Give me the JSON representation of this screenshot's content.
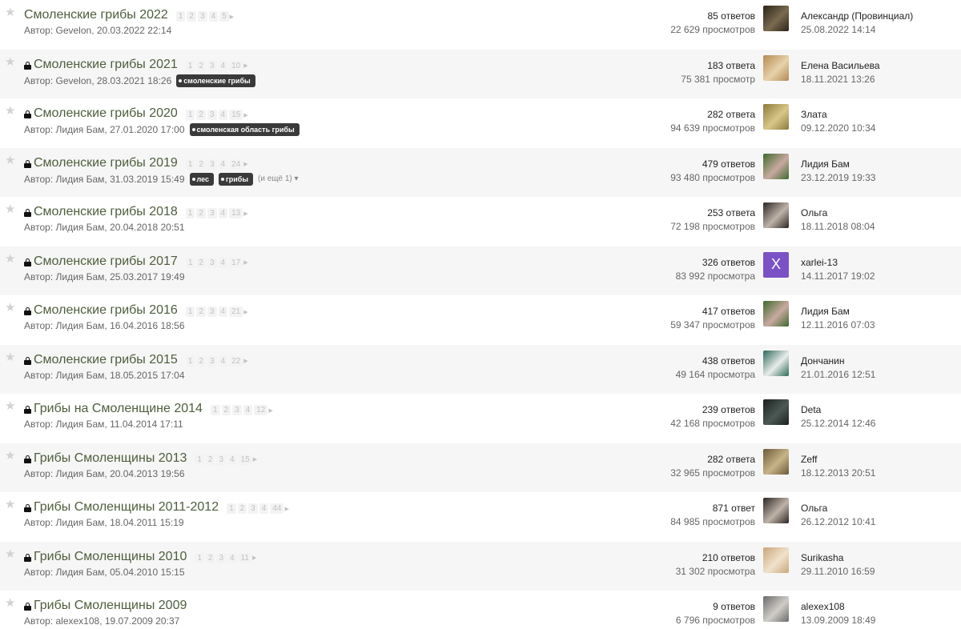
{
  "colors": {
    "accent": "#4e5e3c",
    "tag_bg": "#3a3a3a",
    "row_alt": "#f6f6f6"
  },
  "icons": {
    "star": "star-icon",
    "lock": "lock-icon",
    "page_next": "caret-right-icon",
    "more": "caret-down-icon"
  },
  "topics": [
    {
      "title": "Смоленские грибы 2022",
      "locked": false,
      "pages": [
        "1",
        "2",
        "3",
        "4",
        "5"
      ],
      "author": "Автор: Gevelon, 20.03.2022 22:14",
      "tags": [],
      "more": "",
      "replies": "85 ответов",
      "views": "22 629 просмотров",
      "avatar": {
        "type": "photo",
        "colors": [
          "#2a2418",
          "#7a6a50"
        ]
      },
      "last_user": "Александр (Провинциал)",
      "last_date": "25.08.2022 14:14"
    },
    {
      "title": "Смоленские грибы 2021",
      "locked": true,
      "pages": [
        "1",
        "2",
        "3",
        "4",
        "10"
      ],
      "author": "Автор: Gevelon, 28.03.2021 18:26",
      "tags": [
        "смоленские грибы"
      ],
      "more": "",
      "replies": "183 ответа",
      "views": "75 381 просмотр",
      "avatar": {
        "type": "photo",
        "colors": [
          "#b58a52",
          "#e7d2aa"
        ]
      },
      "last_user": "Елена Васильева",
      "last_date": "18.11.2021 13:26"
    },
    {
      "title": "Смоленские грибы 2020",
      "locked": true,
      "pages": [
        "1",
        "2",
        "3",
        "4",
        "15"
      ],
      "author": "Автор: Лидия Бам, 27.01.2020 17:00",
      "tags": [
        "смоленская область грибы"
      ],
      "more": "",
      "replies": "282 ответа",
      "views": "94 639 просмотров",
      "avatar": {
        "type": "photo",
        "colors": [
          "#8a7a3a",
          "#d9c78a"
        ]
      },
      "last_user": "Злата",
      "last_date": "09.12.2020 10:34"
    },
    {
      "title": "Смоленские грибы 2019",
      "locked": true,
      "pages": [
        "1",
        "2",
        "3",
        "4",
        "24"
      ],
      "author": "Автор: Лидия Бам, 31.03.2019 15:49",
      "tags": [
        "лес",
        "грибы"
      ],
      "more": "(и ещё 1)",
      "replies": "479 ответов",
      "views": "93 480 просмотров",
      "avatar": {
        "type": "photo",
        "colors": [
          "#3e6a2e",
          "#c9a9a0"
        ]
      },
      "last_user": "Лидия Бам",
      "last_date": "23.12.2019 19:33"
    },
    {
      "title": "Смоленские грибы 2018",
      "locked": true,
      "pages": [
        "1",
        "2",
        "3",
        "4",
        "13"
      ],
      "author": "Автор: Лидия Бам, 20.04.2018 20:51",
      "tags": [],
      "more": "",
      "replies": "253 ответа",
      "views": "72 198 просмотров",
      "avatar": {
        "type": "photo",
        "colors": [
          "#2b2623",
          "#bfb3a8"
        ]
      },
      "last_user": "Ольга",
      "last_date": "18.11.2018 08:04"
    },
    {
      "title": "Смоленские грибы 2017",
      "locked": true,
      "pages": [
        "1",
        "2",
        "3",
        "4",
        "17"
      ],
      "author": "Автор: Лидия Бам, 25.03.2017 19:49",
      "tags": [],
      "more": "",
      "replies": "326 ответов",
      "views": "83 992 просмотра",
      "avatar": {
        "type": "letter",
        "letter": "X",
        "colors": [
          "#7a52c6",
          "#7a52c6"
        ]
      },
      "last_user": "xarlei-13",
      "last_date": "14.11.2017 19:02"
    },
    {
      "title": "Смоленские грибы 2016",
      "locked": true,
      "pages": [
        "1",
        "2",
        "3",
        "4",
        "21"
      ],
      "author": "Автор: Лидия Бам, 16.04.2016 18:56",
      "tags": [],
      "more": "",
      "replies": "417 ответов",
      "views": "59 347 просмотров",
      "avatar": {
        "type": "photo",
        "colors": [
          "#3e6a2e",
          "#c9a9a0"
        ]
      },
      "last_user": "Лидия Бам",
      "last_date": "12.11.2016 07:03"
    },
    {
      "title": "Смоленские грибы 2015",
      "locked": true,
      "pages": [
        "1",
        "2",
        "3",
        "4",
        "22"
      ],
      "author": "Автор: Лидия Бам, 18.05.2015 17:04",
      "tags": [],
      "more": "",
      "replies": "438 ответов",
      "views": "49 164 просмотра",
      "avatar": {
        "type": "photo",
        "colors": [
          "#2e6a5a",
          "#e8ecea"
        ]
      },
      "last_user": "Дончанин",
      "last_date": "21.01.2016 12:51"
    },
    {
      "title": "Грибы на Смоленщине 2014",
      "locked": true,
      "pages": [
        "1",
        "2",
        "3",
        "4",
        "12"
      ],
      "author": "Автор: Лидия Бам, 11.04.2014 17:11",
      "tags": [],
      "more": "",
      "replies": "239 ответов",
      "views": "42 168 просмотров",
      "avatar": {
        "type": "photo",
        "colors": [
          "#1c1f20",
          "#4b5a55"
        ]
      },
      "last_user": "Deta",
      "last_date": "25.12.2014 12:46"
    },
    {
      "title": "Грибы Смоленщины 2013",
      "locked": true,
      "pages": [
        "1",
        "2",
        "3",
        "4",
        "15"
      ],
      "author": "Автор: Лидия Бам, 20.04.2013 19:56",
      "tags": [],
      "more": "",
      "replies": "282 ответа",
      "views": "32 965 просмотров",
      "avatar": {
        "type": "photo",
        "colors": [
          "#6a5a3a",
          "#c8b488"
        ]
      },
      "last_user": "Zeff",
      "last_date": "18.12.2013 20:51"
    },
    {
      "title": "Грибы Смоленщины 2011-2012",
      "locked": true,
      "pages": [
        "1",
        "2",
        "3",
        "4",
        "44"
      ],
      "author": "Автор: Лидия Бам, 18.04.2011 15:19",
      "tags": [],
      "more": "",
      "replies": "871 ответ",
      "views": "84 985 просмотров",
      "avatar": {
        "type": "photo",
        "colors": [
          "#2b2623",
          "#bfb3a8"
        ]
      },
      "last_user": "Ольга",
      "last_date": "26.12.2012 10:41"
    },
    {
      "title": "Грибы Смоленщины 2010",
      "locked": true,
      "pages": [
        "1",
        "2",
        "3",
        "4",
        "11"
      ],
      "author": "Автор: Лидия Бам, 05.04.2010 15:15",
      "tags": [],
      "more": "",
      "replies": "210 ответов",
      "views": "31 302 просмотра",
      "avatar": {
        "type": "photo",
        "colors": [
          "#c9a679",
          "#f0e2cc"
        ]
      },
      "last_user": "Surikasha",
      "last_date": "29.11.2010 16:59"
    },
    {
      "title": "Грибы Смоленщины 2009",
      "locked": true,
      "pages": [],
      "author": "Автор: alexex108, 19.07.2009 20:37",
      "tags": [],
      "more": "",
      "replies": "9 ответов",
      "views": "6 796 просмотров",
      "avatar": {
        "type": "photo",
        "colors": [
          "#6b6b6b",
          "#d0cdc8"
        ]
      },
      "last_user": "alexex108",
      "last_date": "13.09.2009 18:49"
    }
  ]
}
